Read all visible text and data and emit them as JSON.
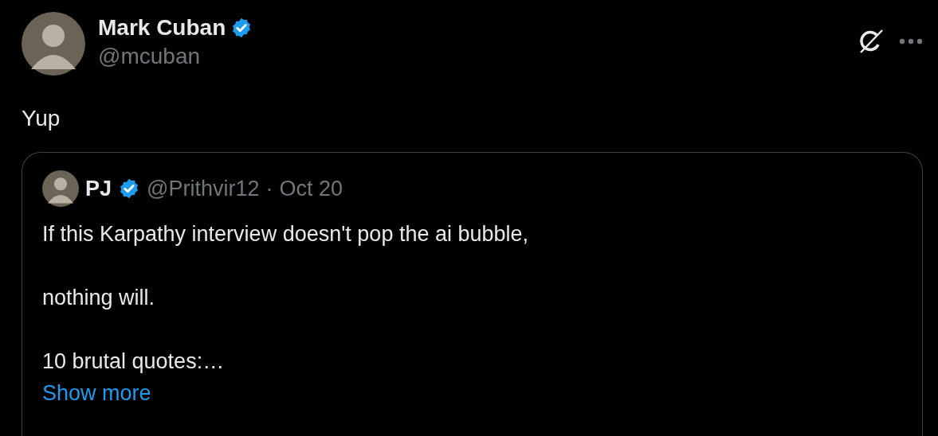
{
  "post": {
    "author": "Mark Cuban",
    "verified": true,
    "handle": "@mcuban",
    "text": "Yup"
  },
  "quoted_post": {
    "author": "PJ",
    "verified": true,
    "handle": "@Prithvir12",
    "separator": "·",
    "date": "Oct 20",
    "lines": [
      "If this Karpathy interview doesn't pop the ai bubble,",
      "nothing will.",
      "10 brutal quotes:…"
    ],
    "show_more": "Show more"
  }
}
